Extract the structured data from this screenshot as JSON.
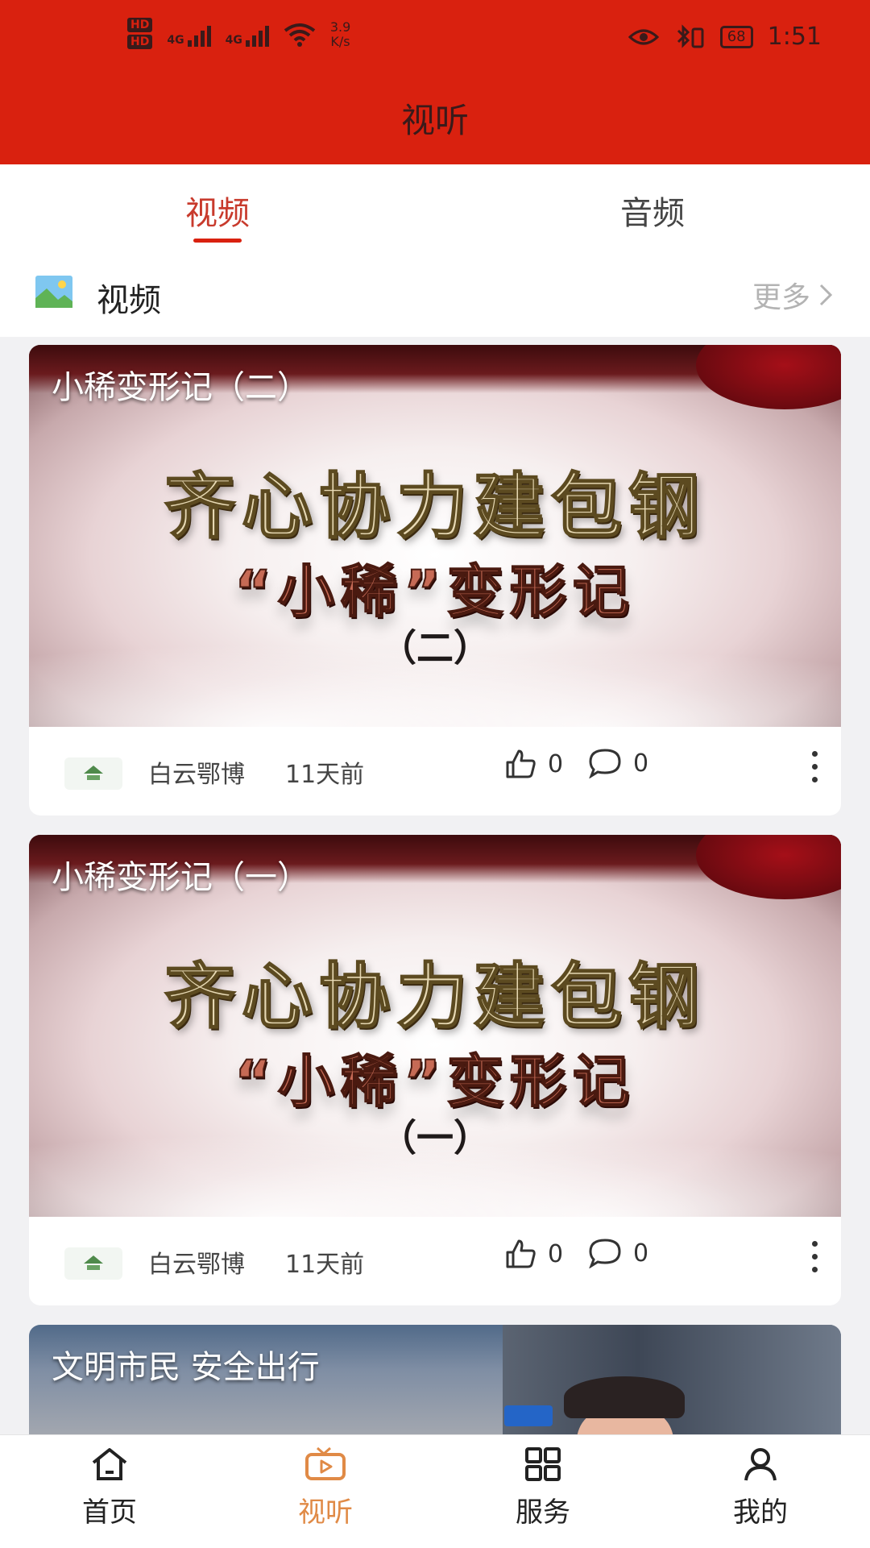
{
  "status_bar": {
    "hd1": "HD",
    "hd2": "HD",
    "net1": "4G",
    "net2": "4G",
    "speed_value": "3.9",
    "speed_unit": "K/s",
    "battery": "68",
    "time": "1:51"
  },
  "header": {
    "title": "视听"
  },
  "tabs": [
    {
      "label": "视频",
      "active": true
    },
    {
      "label": "音频",
      "active": false
    }
  ],
  "section": {
    "title": "视频",
    "more_label": "更多"
  },
  "cards": [
    {
      "caption": "小稀变形记（二）",
      "thumb_line1": "齐心协力建包钢",
      "thumb_line2": "“小稀”变形记",
      "thumb_line3": "（二）",
      "author": "白云鄂博",
      "time": "11天前",
      "likes": "0",
      "comments": "0"
    },
    {
      "caption": "小稀变形记（一）",
      "thumb_line1": "齐心协力建包钢",
      "thumb_line2": "“小稀”变形记",
      "thumb_line3": "（一）",
      "author": "白云鄂博",
      "time": "11天前",
      "likes": "0",
      "comments": "0"
    },
    {
      "caption": "文明市民  安全出行"
    }
  ],
  "bottom_nav": [
    {
      "label": "首页",
      "icon": "home-icon",
      "active": false
    },
    {
      "label": "视听",
      "icon": "tv-icon",
      "active": true
    },
    {
      "label": "服务",
      "icon": "grid-icon",
      "active": false
    },
    {
      "label": "我的",
      "icon": "person-icon",
      "active": false
    }
  ],
  "colors": {
    "header_red": "#d9210f",
    "active_tab": "#c83a2c",
    "nav_active": "#e08a46"
  }
}
